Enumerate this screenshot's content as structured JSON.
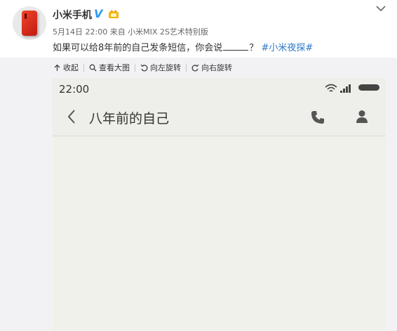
{
  "post": {
    "username": "小米手机",
    "verified_badge": "V",
    "meta": "5月14日 22:00 来自 小米MIX 2S艺术特别版",
    "text_before": "如果可以给8年前的自己发条短信，你会说",
    "text_after": "？",
    "hashtag": "#小米夜探#"
  },
  "toolbar": {
    "collapse": "收起",
    "view_large": "查看大图",
    "rotate_left": "向左旋转",
    "rotate_right": "向右旋转"
  },
  "phone": {
    "time": "22:00",
    "contact": "八年前的自己"
  },
  "colors": {
    "hashtag": "#2b78c8",
    "verified": "#2d9bf0",
    "avatar_phone": "#e2301e",
    "screenshot_bg": "#f1f1ec"
  },
  "icons": [
    "chevron-down-icon",
    "vip-icon",
    "collapse-icon",
    "zoom-icon",
    "rotate-left-icon",
    "rotate-right-icon",
    "wifi-icon",
    "signal-icon",
    "battery-icon",
    "back-icon",
    "phone-call-icon",
    "contact-person-icon"
  ]
}
